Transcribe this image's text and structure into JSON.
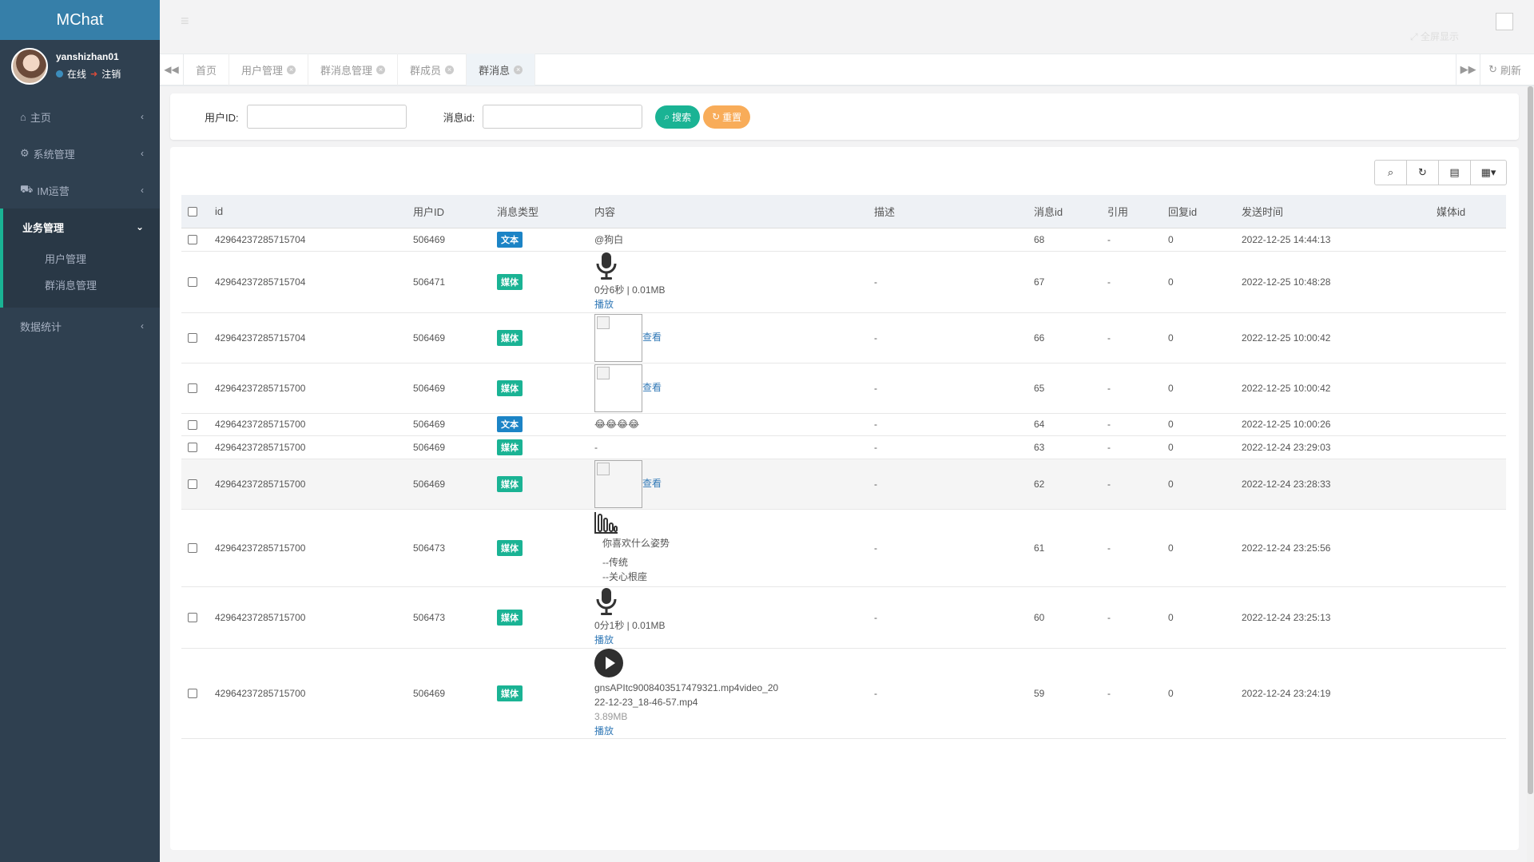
{
  "app": {
    "brand": "MChat"
  },
  "user": {
    "name": "yanshizhan01",
    "status": "在线",
    "logout": "注销"
  },
  "sidebar": {
    "items": [
      {
        "label": "主页",
        "icon": "home-icon"
      },
      {
        "label": "系统管理",
        "icon": "gear-icon"
      },
      {
        "label": "IM运营",
        "icon": "car-icon"
      },
      {
        "label": "业务管理",
        "icon": "",
        "expanded": true,
        "children": [
          {
            "label": "用户管理"
          },
          {
            "label": "群消息管理"
          }
        ]
      },
      {
        "label": "数据统计",
        "icon": ""
      }
    ]
  },
  "header": {
    "fullscreen": "全屏显示"
  },
  "tabs": {
    "items": [
      {
        "label": "首页",
        "closable": false
      },
      {
        "label": "用户管理",
        "closable": true
      },
      {
        "label": "群消息管理",
        "closable": true
      },
      {
        "label": "群成员",
        "closable": true
      },
      {
        "label": "群消息",
        "closable": true,
        "active": true
      }
    ],
    "refresh": "刷新"
  },
  "search": {
    "user_id_label": "用户ID:",
    "user_id_value": "",
    "msg_id_label": "消息id:",
    "msg_id_value": "",
    "search_btn": "搜索",
    "reset_btn": "重置"
  },
  "table": {
    "columns": [
      "id",
      "用户ID",
      "消息类型",
      "内容",
      "描述",
      "消息id",
      "引用",
      "回复id",
      "发送时间",
      "媒体id"
    ],
    "rows": [
      {
        "id": "42964237285715704",
        "uid": "506469",
        "type": "文本",
        "content": {
          "kind": "text",
          "text": "@狗白"
        },
        "desc": "",
        "msgid": "68",
        "ref": "-",
        "reply": "0",
        "time": "2022-12-25 14:44:13"
      },
      {
        "id": "42964237285715704",
        "uid": "506471",
        "type": "媒体",
        "content": {
          "kind": "audio",
          "meta": "0分6秒 | 0.01MB",
          "action": "播放"
        },
        "desc": "-",
        "msgid": "67",
        "ref": "-",
        "reply": "0",
        "time": "2022-12-25 10:48:28"
      },
      {
        "id": "42964237285715704",
        "uid": "506469",
        "type": "媒体",
        "content": {
          "kind": "image",
          "action": "查看"
        },
        "desc": "-",
        "msgid": "66",
        "ref": "-",
        "reply": "0",
        "time": "2022-12-25 10:00:42"
      },
      {
        "id": "42964237285715700",
        "uid": "506469",
        "type": "媒体",
        "content": {
          "kind": "image",
          "action": "查看"
        },
        "desc": "-",
        "msgid": "65",
        "ref": "-",
        "reply": "0",
        "time": "2022-12-25 10:00:42"
      },
      {
        "id": "42964237285715700",
        "uid": "506469",
        "type": "文本",
        "content": {
          "kind": "emoji",
          "text": "😂😂😂😂"
        },
        "desc": "-",
        "msgid": "64",
        "ref": "-",
        "reply": "0",
        "time": "2022-12-25 10:00:26"
      },
      {
        "id": "42964237285715700",
        "uid": "506469",
        "type": "媒体",
        "content": {
          "kind": "text",
          "text": "-"
        },
        "desc": "-",
        "msgid": "63",
        "ref": "-",
        "reply": "0",
        "time": "2022-12-24 23:29:03"
      },
      {
        "id": "42964237285715700",
        "uid": "506469",
        "type": "媒体",
        "content": {
          "kind": "image",
          "action": "查看"
        },
        "desc": "-",
        "msgid": "62",
        "ref": "-",
        "reply": "0",
        "time": "2022-12-24 23:28:33"
      },
      {
        "id": "42964237285715700",
        "uid": "506473",
        "type": "媒体",
        "content": {
          "kind": "poll",
          "lines": [
            "你喜欢什么姿势",
            "--传统",
            "--关心根座"
          ]
        },
        "desc": "-",
        "msgid": "61",
        "ref": "-",
        "reply": "0",
        "time": "2022-12-24 23:25:56"
      },
      {
        "id": "42964237285715700",
        "uid": "506473",
        "type": "媒体",
        "content": {
          "kind": "audio",
          "meta": "0分1秒 | 0.01MB",
          "action": "播放"
        },
        "desc": "-",
        "msgid": "60",
        "ref": "-",
        "reply": "0",
        "time": "2022-12-24 23:25:13"
      },
      {
        "id": "42964237285715700",
        "uid": "506469",
        "type": "媒体",
        "content": {
          "kind": "video",
          "filename": "gnsAPItc9008403517479321.mp4video_2022-12-23_18-46-57.mp4",
          "filename_line1": "gnsAPItc9008403517479321.mp4video_20",
          "filename_line2": "22-12-23_18-46-57.mp4",
          "size": "3.89MB",
          "action": "播放"
        },
        "desc": "-",
        "msgid": "59",
        "ref": "-",
        "reply": "0",
        "time": "2022-12-24 23:24:19"
      }
    ]
  },
  "colors": {
    "sidebar": "#2f4050",
    "brand": "#367fa9",
    "primary": "#1ab394",
    "warning": "#f8ac59",
    "text_badge": "#1c84c6"
  }
}
